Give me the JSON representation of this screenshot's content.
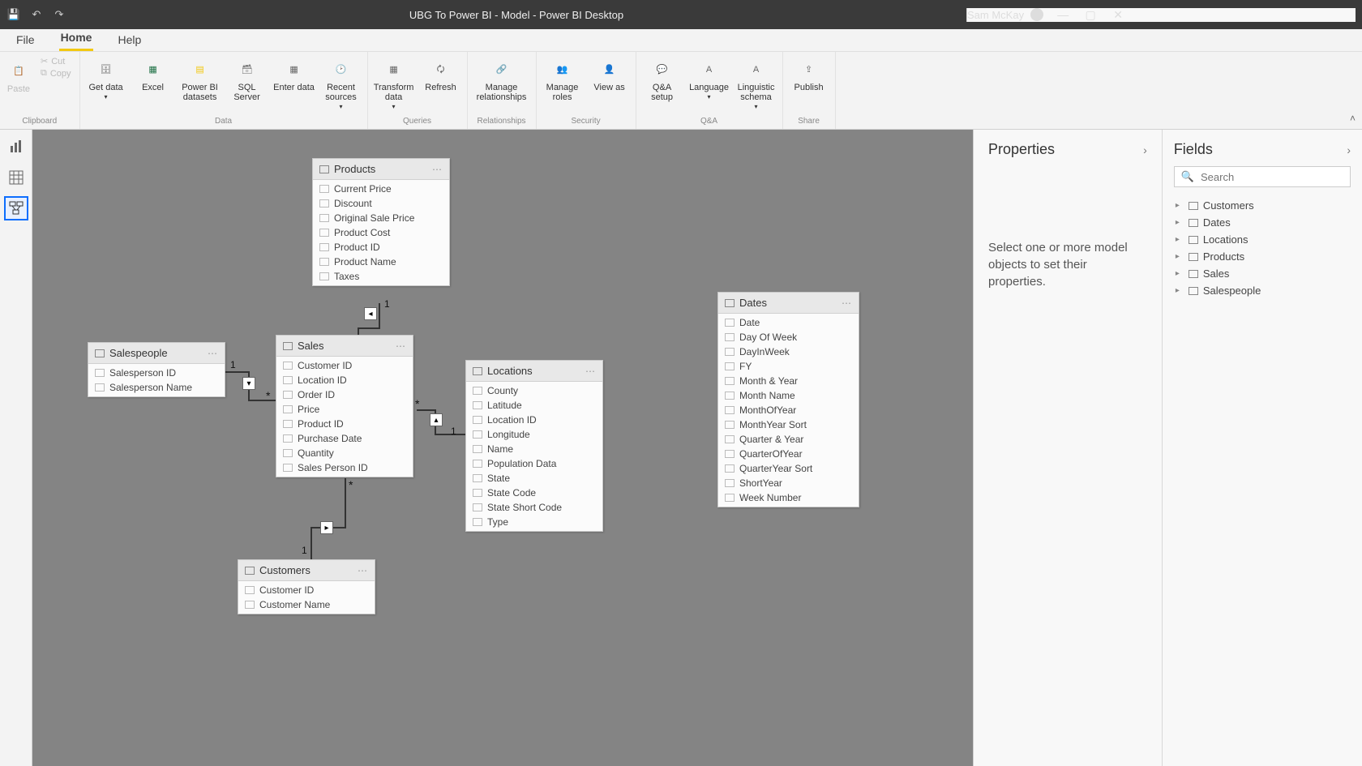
{
  "titlebar": {
    "title": "UBG To Power BI - Model - Power BI Desktop",
    "user": "Sam McKay"
  },
  "menu": {
    "file": "File",
    "home": "Home",
    "help": "Help"
  },
  "ribbon": {
    "clipboard": {
      "paste": "Paste",
      "cut": "Cut",
      "copy": "Copy",
      "label": "Clipboard"
    },
    "data": {
      "get": "Get data",
      "excel": "Excel",
      "pbids": "Power BI datasets",
      "sql": "SQL Server",
      "enter": "Enter data",
      "recent": "Recent sources",
      "label": "Data"
    },
    "queries": {
      "transform": "Transform data",
      "refresh": "Refresh",
      "label": "Queries"
    },
    "relationships": {
      "manage": "Manage relationships",
      "label": "Relationships"
    },
    "security": {
      "roles": "Manage roles",
      "viewas": "View as",
      "label": "Security"
    },
    "qa": {
      "setup": "Q&A setup",
      "language": "Language",
      "schema": "Linguistic schema",
      "label": "Q&A"
    },
    "share": {
      "publish": "Publish",
      "label": "Share"
    }
  },
  "tables": {
    "products": {
      "name": "Products",
      "cols": [
        "Current Price",
        "Discount",
        "Original Sale Price",
        "Product Cost",
        "Product ID",
        "Product Name",
        "Taxes"
      ]
    },
    "salespeople": {
      "name": "Salespeople",
      "cols": [
        "Salesperson ID",
        "Salesperson Name"
      ]
    },
    "sales": {
      "name": "Sales",
      "cols": [
        "Customer ID",
        "Location ID",
        "Order ID",
        "Price",
        "Product ID",
        "Purchase Date",
        "Quantity",
        "Sales Person ID"
      ]
    },
    "locations": {
      "name": "Locations",
      "cols": [
        "County",
        "Latitude",
        "Location ID",
        "Longitude",
        "Name",
        "Population Data",
        "State",
        "State Code",
        "State Short Code",
        "Type"
      ]
    },
    "dates": {
      "name": "Dates",
      "cols": [
        "Date",
        "Day Of Week",
        "DayInWeek",
        "FY",
        "Month & Year",
        "Month Name",
        "MonthOfYear",
        "MonthYear Sort",
        "Quarter & Year",
        "QuarterOfYear",
        "QuarterYear Sort",
        "ShortYear",
        "Week Number"
      ]
    },
    "customers": {
      "name": "Customers",
      "cols": [
        "Customer ID",
        "Customer Name"
      ]
    }
  },
  "properties": {
    "title": "Properties",
    "msg": "Select one or more model objects to set their properties."
  },
  "fields": {
    "title": "Fields",
    "search_placeholder": "Search",
    "items": [
      "Customers",
      "Dates",
      "Locations",
      "Products",
      "Sales",
      "Salespeople"
    ]
  },
  "cardinality": {
    "one": "1",
    "many": "*"
  }
}
